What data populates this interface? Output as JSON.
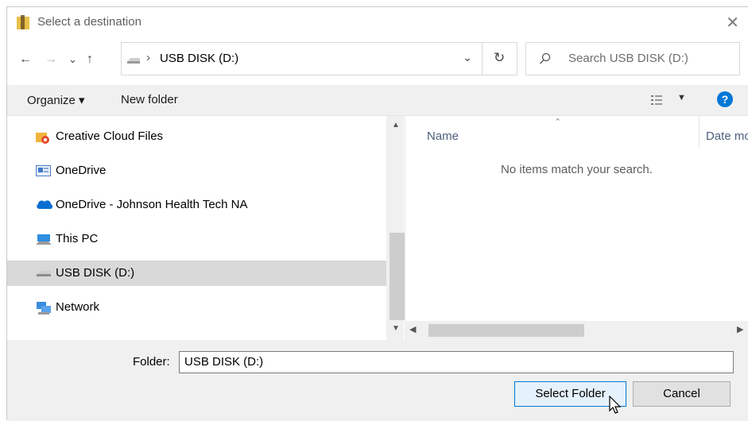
{
  "window": {
    "title": "Select a destination",
    "close_glyph": "✕"
  },
  "nav": {
    "back": "←",
    "forward": "→",
    "recent": "⌄",
    "up": "↑",
    "breadcrumb_sep": "›",
    "address": "USB DISK (D:)",
    "address_dropdown": "⌄",
    "refresh": "↻",
    "search_placeholder": "Search USB DISK (D:)"
  },
  "toolbar": {
    "organize": "Organize ▾",
    "new_folder": "New folder",
    "help": "?"
  },
  "sidebar": {
    "items": [
      {
        "label": "Creative Cloud Files",
        "icon": "creative-cloud-icon"
      },
      {
        "label": "OneDrive",
        "icon": "onedrive-icon"
      },
      {
        "label": "OneDrive - Johnson Health Tech NA",
        "icon": "onedrive-cloud-icon"
      },
      {
        "label": "This PC",
        "icon": "this-pc-icon"
      },
      {
        "label": "USB DISK (D:)",
        "icon": "usb-drive-icon",
        "selected": true
      },
      {
        "label": "Network",
        "icon": "network-icon"
      }
    ]
  },
  "filelist": {
    "columns": [
      "Name",
      "Date mo"
    ],
    "empty_message": "No items match your search."
  },
  "footer": {
    "folder_label": "Folder:",
    "folder_value": "USB DISK (D:)",
    "select_button": "Select Folder",
    "cancel_button": "Cancel"
  },
  "colors": {
    "accent": "#0078d7",
    "selected_bg": "#d9d9d9",
    "toolbar_bg": "#f0f0f0"
  }
}
